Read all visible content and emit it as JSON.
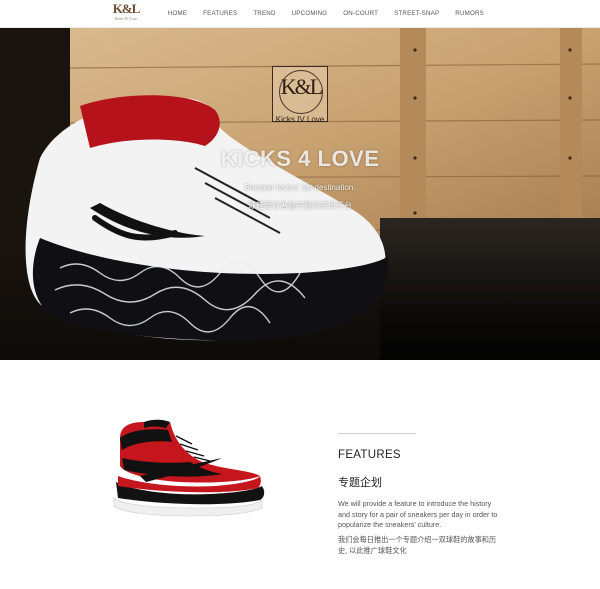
{
  "header": {
    "logo_text": "K&L",
    "logo_subtext": "Kicks IV Love",
    "nav": [
      {
        "label": "HOME"
      },
      {
        "label": "FEATURES"
      },
      {
        "label": "TREND"
      },
      {
        "label": "UPCOMING"
      },
      {
        "label": "ON-COURT"
      },
      {
        "label": "STREET-SNAP"
      },
      {
        "label": "RUMORS"
      }
    ]
  },
  "hero": {
    "emblem_text": "K&L",
    "emblem_caption": "Kicks IV Love",
    "title": "KICKS 4 LOVE",
    "subtitle": "Sneaker lovers' 1st destination.",
    "subtitle_zh": "球鞋爱好者最中意的资讯平台"
  },
  "features": {
    "title": "FEATURES",
    "title_zh": "专题企划",
    "description": "We will provide a feature to introduce the history and story for a pair of sneakers per day in order to popularize the sneakers' culture.",
    "description_zh": "我们会每日推出一个专题介绍一双球鞋的故事和历史, 以此推广球鞋文化"
  }
}
